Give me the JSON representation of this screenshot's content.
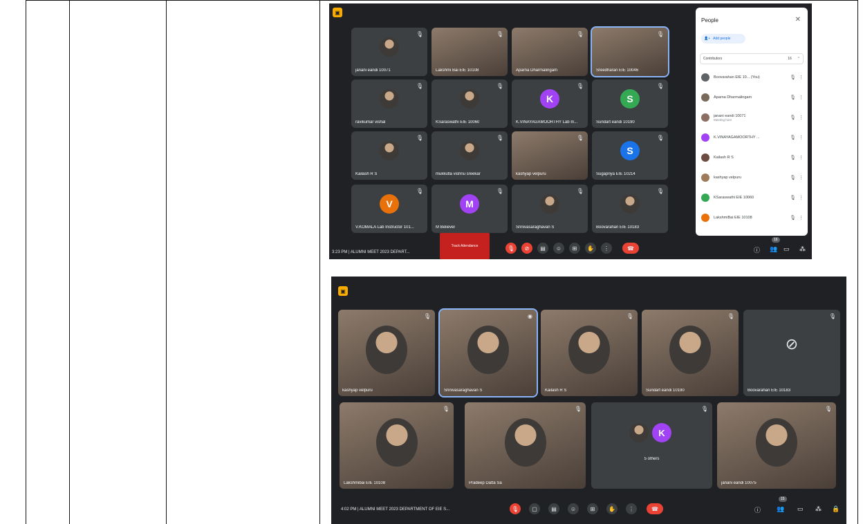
{
  "screenshot1": {
    "tiles": [
      {
        "name": "janani eandi 10071",
        "kind": "photo"
      },
      {
        "name": "Lakshmi Bai EIE 10108",
        "kind": "video"
      },
      {
        "name": "Aparna Dharmalingam",
        "kind": "video"
      },
      {
        "name": "Sreedharan EIE 10046",
        "kind": "video"
      },
      {
        "name": "ravikumar vishal",
        "kind": "photo"
      },
      {
        "name": "KSaraswathi EIE 10060",
        "kind": "photo"
      },
      {
        "name": "K.VINAYAGAMOORTHY Lab In...",
        "kind": "letter",
        "letter": "K",
        "color": "#a142f4"
      },
      {
        "name": "Sundart eandi 10190",
        "kind": "letter",
        "letter": "S",
        "color": "#34a853"
      },
      {
        "name": "Kailash R S",
        "kind": "photo"
      },
      {
        "name": "mukkutla vishnu sreekar",
        "kind": "photo"
      },
      {
        "name": "kashyap velpuru",
        "kind": "video"
      },
      {
        "name": "Sugapriya EIE 10214",
        "kind": "letter",
        "letter": "S",
        "color": "#1a73e8"
      },
      {
        "name": "V.KOMALA Lab Instructor 101...",
        "kind": "letter",
        "letter": "V",
        "color": "#e8710a"
      },
      {
        "name": "M Believer",
        "kind": "letter",
        "letter": "M",
        "color": "#a142f4"
      },
      {
        "name": "Srinivasaraghavan S",
        "kind": "photo"
      },
      {
        "name": "Boovarahan EIE 10183",
        "kind": "photo"
      }
    ],
    "meeting_info": "3:23 PM  |  ALUMNI MEET 2023 DEPART...",
    "track_attendance": "Track Attendance",
    "people_badge": "16",
    "people_panel": {
      "title": "People",
      "add_people": "Add people",
      "section": "Contributors",
      "section_count": "16",
      "members": [
        {
          "name": "Boovarahan EIE 10... (You)",
          "sub": ""
        },
        {
          "name": "Aparna Dharmalingam",
          "sub": ""
        },
        {
          "name": "janani eandi 10071",
          "sub": "Meeting host"
        },
        {
          "name": "K.VINAYAGAMOORTHY ...",
          "sub": ""
        },
        {
          "name": "Kailash R S",
          "sub": ""
        },
        {
          "name": "kashyap velpuru",
          "sub": ""
        },
        {
          "name": "KSaraswathi EIE 10060",
          "sub": ""
        },
        {
          "name": "LakshmiBai EIE 10108",
          "sub": ""
        }
      ]
    }
  },
  "screenshot2": {
    "tiles": [
      {
        "name": "kashyap velpuru",
        "kind": "video"
      },
      {
        "name": "Srinivasaraghavan S",
        "kind": "video"
      },
      {
        "name": "Kailash R S",
        "kind": "video"
      },
      {
        "name": "Sundart eandi 10190",
        "kind": "video"
      },
      {
        "name": "Boovarahan EIE 10183",
        "kind": "camoff"
      },
      {
        "name": "Lakshmibai EIE 10108",
        "kind": "video"
      },
      {
        "name": "Pradeep Datta Sa",
        "kind": "video"
      },
      {
        "name": "5 others",
        "kind": "others",
        "letter": "K"
      },
      {
        "name": "janani eandi 10075",
        "kind": "video"
      }
    ],
    "meeting_info": "4:02 PM  |  ALUMNI MEET 2023 DEPARTMENT OF EIE S...",
    "people_badge": "15"
  }
}
